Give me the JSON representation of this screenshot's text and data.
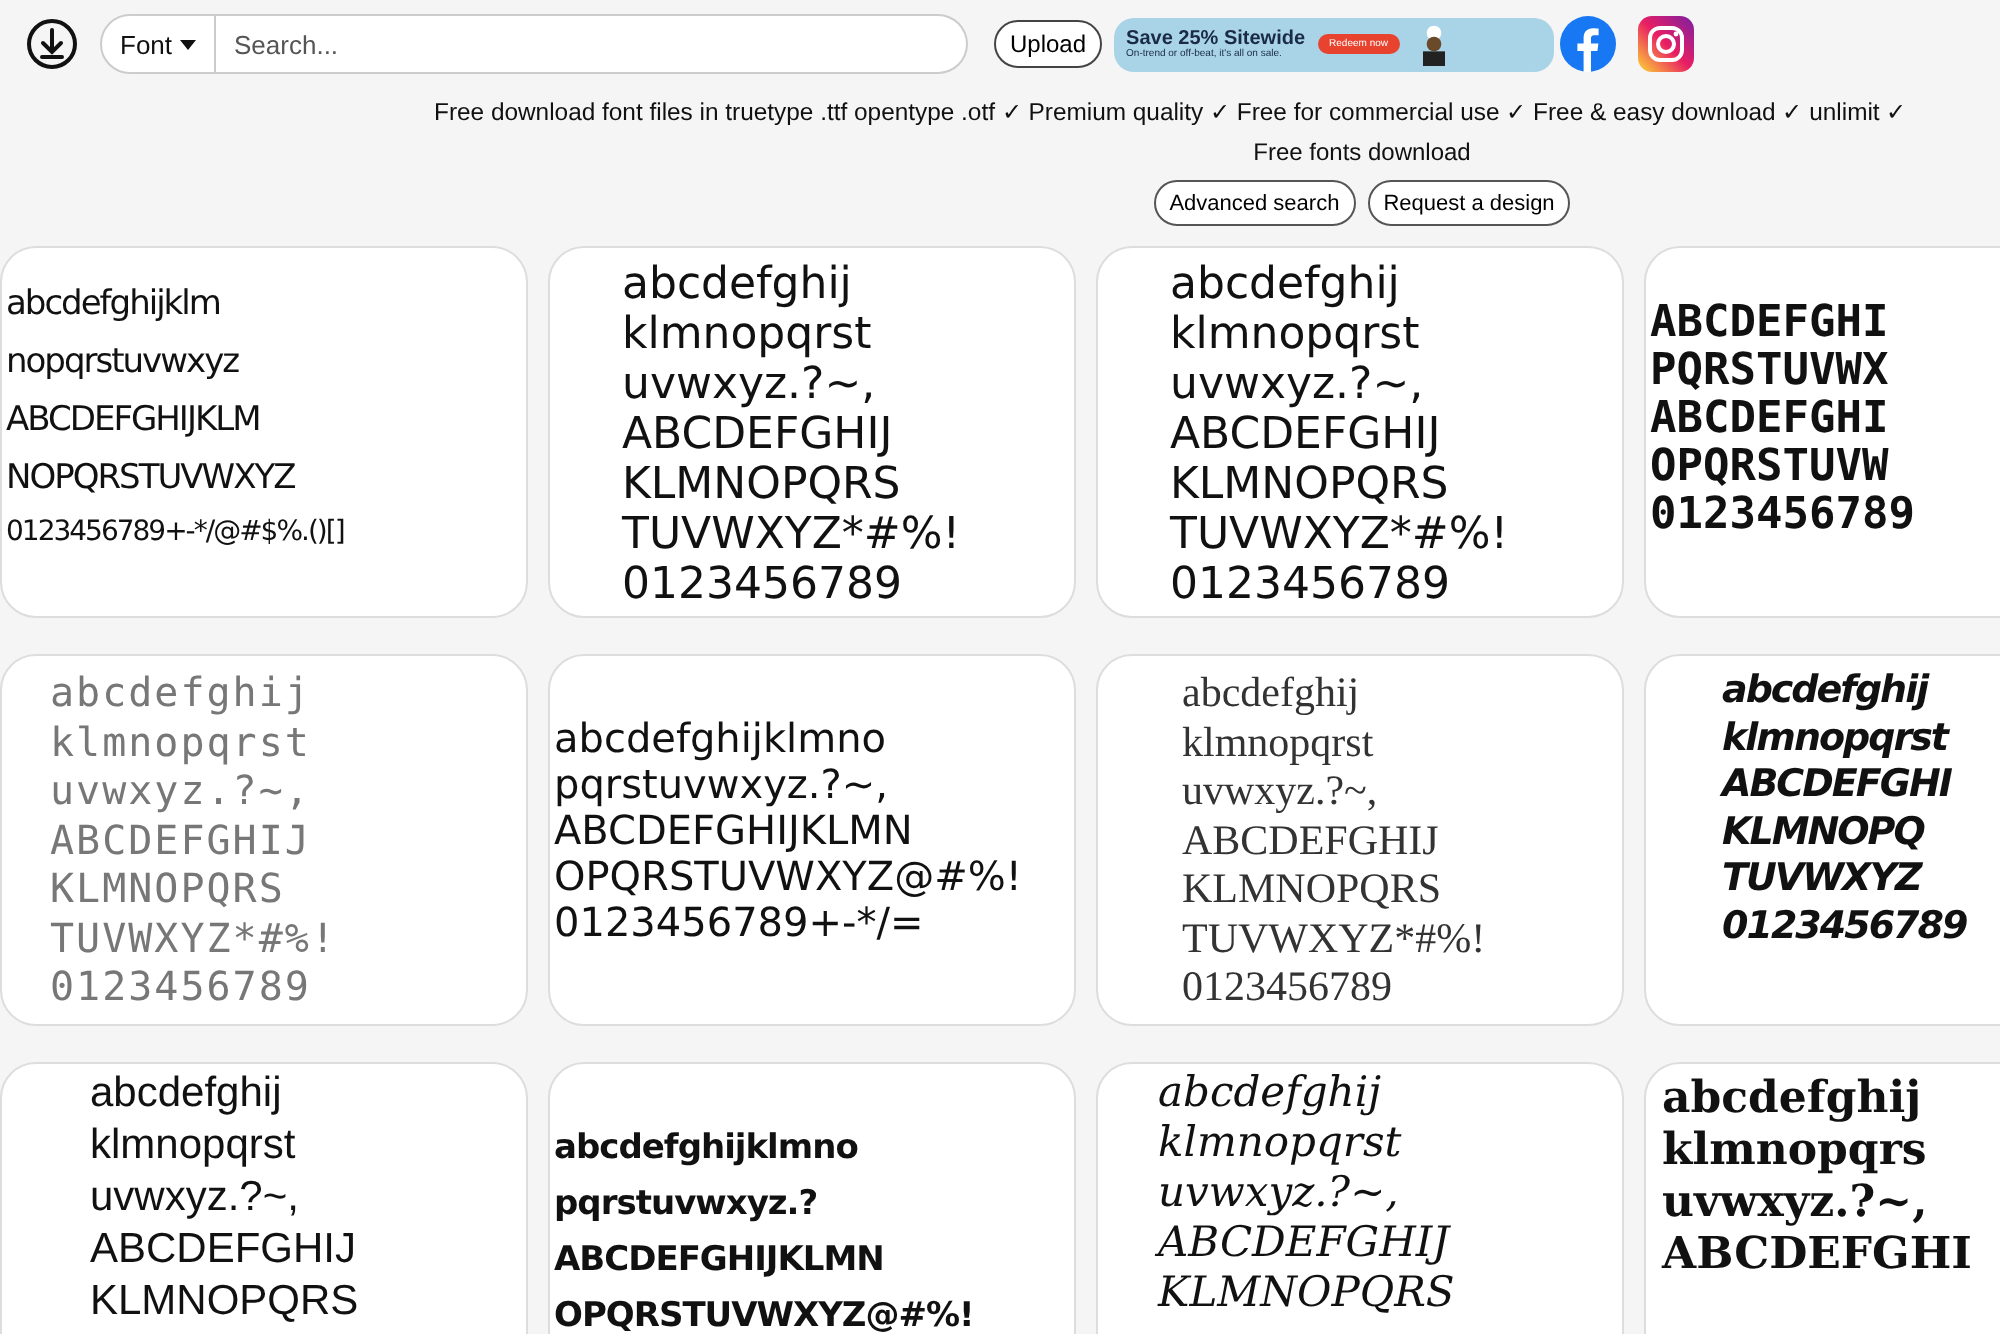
{
  "header": {
    "font_menu": "Font",
    "search": {
      "placeholder": "Search..."
    },
    "upload": "Upload",
    "ad": {
      "headline": "Save 25% Sitewide",
      "subline": "On-trend or off-beat, it's all on sale.",
      "cta": "Redeem now"
    }
  },
  "tagline": "Free download font files in truetype .ttf opentype .otf ✓ Premium quality ✓ Free for commercial use ✓ Free & easy download ✓ unlimit ✓",
  "subtitle": "Free fonts download",
  "actions": [
    "Advanced search",
    "Request a design"
  ],
  "fonts": [
    {
      "kind": "hand",
      "lines": [
        "abcdefghijklm",
        "nopqrstuvwxyz",
        "ABCDEFGHIJKLM",
        "NOPQRSTUVWXYZ",
        "0123456789+-*/@#$%.()[]"
      ]
    },
    {
      "kind": "marker",
      "lines": [
        "abcdefghij",
        "klmnopqrst",
        "uvwxyz.?~,",
        "ABCDEFGHIJ",
        "KLMNOPQRS",
        "TUVWXYZ*#%!",
        "0123456789"
      ]
    },
    {
      "kind": "marker",
      "lines": [
        "abcdefghij",
        "klmnopqrst",
        "uvwxyz.?~,",
        "ABCDEFGHIJ",
        "KLMNOPQRS",
        "TUVWXYZ*#%!",
        "0123456789"
      ]
    },
    {
      "kind": "pixel",
      "lines": [
        "ABCDEFGHI",
        "PQRSTUVWX",
        "ABCDEFGHI",
        "OPQRSTUVW",
        "0123456789"
      ]
    },
    {
      "kind": "dot",
      "lines": [
        "abcdefghij",
        "klmnopqrst",
        "uvwxyz.?~,",
        "ABCDEFGHIJ",
        "KLMNOPQRS",
        "TUVWXYZ*#%!",
        "0123456789"
      ]
    },
    {
      "kind": "thin",
      "lines": [
        "abcdefghijklmno",
        "pqrstuvwxyz.?~,",
        "ABCDEFGHIJKLMN",
        "OPQRSTUVWXYZ@#%!",
        "0123456789+-*/="
      ]
    },
    {
      "kind": "serif",
      "lines": [
        "abcdefghij",
        "klmnopqrst",
        "uvwxyz.?~,",
        "ABCDEFGHIJ",
        "KLMNOPQRS",
        "TUVWXYZ*#%!",
        "0123456789"
      ]
    },
    {
      "kind": "brush",
      "lines": [
        "abcdefghij",
        "klmnopqrst",
        "ABCDEFGHI",
        "KLMNOPQ",
        "TUVWXYZ",
        "0123456789"
      ]
    },
    {
      "kind": "sans",
      "lines": [
        "abcdefghij",
        "klmnopqrst",
        "uvwxyz.?~,",
        "ABCDEFGHIJ",
        "KLMNOPQRS"
      ]
    },
    {
      "kind": "round",
      "lines": [
        "abcdefghijklmno",
        "pqrstuvwxyz.?",
        "ABCDEFGHIJKLMN",
        "OPQRSTUVWXYZ@#%!"
      ]
    },
    {
      "kind": "scrawl",
      "lines": [
        "abcdefghij",
        "klmnopqrst",
        "uvwxyz.?~,",
        "ABCDEFGHIJ",
        "KLMNOPQRS"
      ]
    },
    {
      "kind": "slab",
      "lines": [
        "abcdefghij",
        "klmnopqrs",
        "uvwxyz.?~,",
        "ABCDEFGHI"
      ]
    }
  ]
}
